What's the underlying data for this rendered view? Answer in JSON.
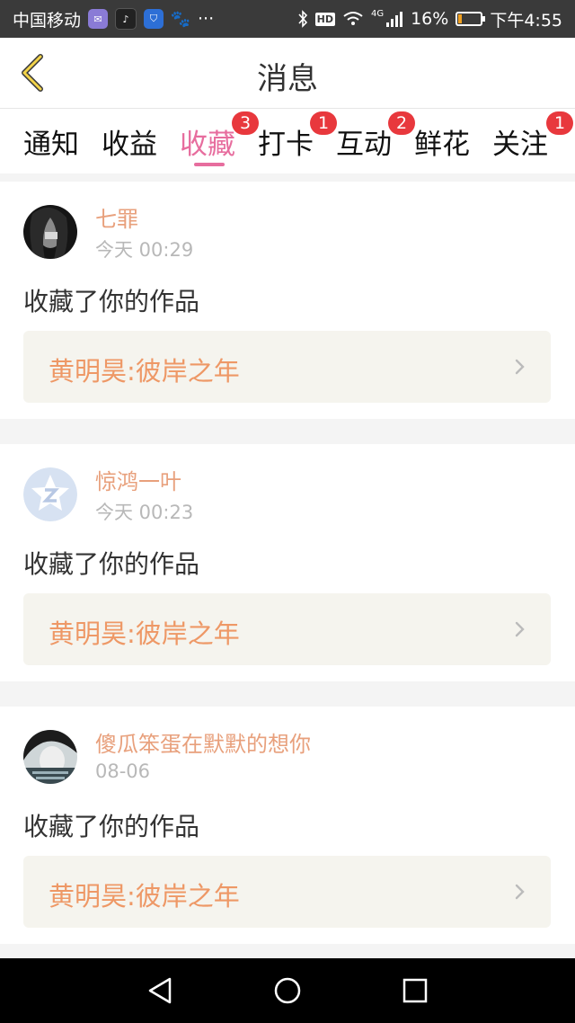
{
  "status_bar": {
    "carrier": "中国移动",
    "more": "···",
    "hd": "HD",
    "network": "4G",
    "battery_text": "16%",
    "battery_level": 0.16,
    "time": "下午4:55"
  },
  "header": {
    "title": "消息"
  },
  "tabs": [
    {
      "label": "通知",
      "badge": ""
    },
    {
      "label": "收益",
      "badge": ""
    },
    {
      "label": "收藏",
      "badge": "3"
    },
    {
      "label": "打卡",
      "badge": "1"
    },
    {
      "label": "互动",
      "badge": "2"
    },
    {
      "label": "鲜花",
      "badge": ""
    },
    {
      "label": "关注",
      "badge": "1"
    }
  ],
  "active_tab": "收藏",
  "colors": {
    "accent": "#e76d9e",
    "username": "#e8a07c",
    "work_title": "#ee9866",
    "badge": "#e8383d"
  },
  "messages": [
    {
      "username": "七罪",
      "time": "今天 00:29",
      "action": "收藏了你的作品",
      "work": "黄明昊:彼岸之年",
      "avatar": "dark-portrait"
    },
    {
      "username": "惊鸿一叶",
      "time": "今天 00:23",
      "action": "收藏了你的作品",
      "work": "黄明昊:彼岸之年",
      "avatar": "default-star"
    },
    {
      "username": "傻瓜笨蛋在默默的想你",
      "time": "08-06",
      "action": "收藏了你的作品",
      "work": "黄明昊:彼岸之年",
      "avatar": "portrait"
    }
  ]
}
